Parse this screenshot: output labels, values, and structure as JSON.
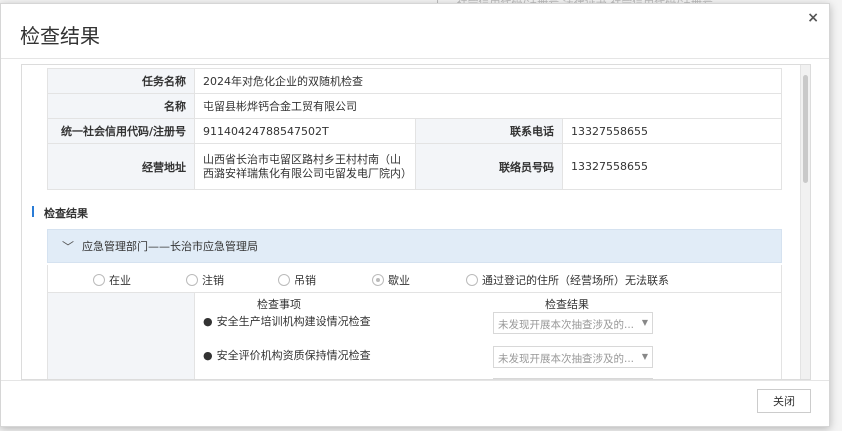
{
  "background": {
    "crumb": "ì ... 社会信用代码/注册号   法律证书    社会信用代码/注册号"
  },
  "dialog": {
    "title": "检查结果",
    "close_glyph": "×",
    "close_button": "关闭"
  },
  "info": {
    "task_label": "任务名称",
    "task_value": "2024年对危化企业的双随机检查",
    "name_label": "名称",
    "name_value": "屯留县彬烨钙合金工贸有限公司",
    "credit_label": "统一社会信用代码/注册号",
    "credit_value": "91140424788547502T",
    "phone_label": "联系电话",
    "phone_value": "13327558655",
    "address_label": "经营地址",
    "address_value": "山西省长治市屯留区路村乡王村村南（山西潞安祥瑞焦化有限公司屯留发电厂院内）",
    "liaison_label": "联络员号码",
    "liaison_value": "13327558655"
  },
  "results": {
    "section_title": "检查结果",
    "dept_label": "应急管理部门——长治市应急管理局",
    "status_options": [
      {
        "label": "在业",
        "checked": false
      },
      {
        "label": "注销",
        "checked": false
      },
      {
        "label": "吊销",
        "checked": false
      },
      {
        "label": "歇业",
        "checked": true
      },
      {
        "label": "通过登记的住所（经营场所）无法联系",
        "checked": false
      }
    ],
    "col_item": "检查事项",
    "col_result": "检查结果",
    "items": [
      {
        "bullet": "●",
        "label": "安全生产培训机构建设情况检查",
        "result": "未发现开展本次抽查涉及的..."
      },
      {
        "bullet": "●",
        "label": "安全评价机构资质保持情况检查",
        "result": "未发现开展本次抽查涉及的..."
      }
    ]
  }
}
